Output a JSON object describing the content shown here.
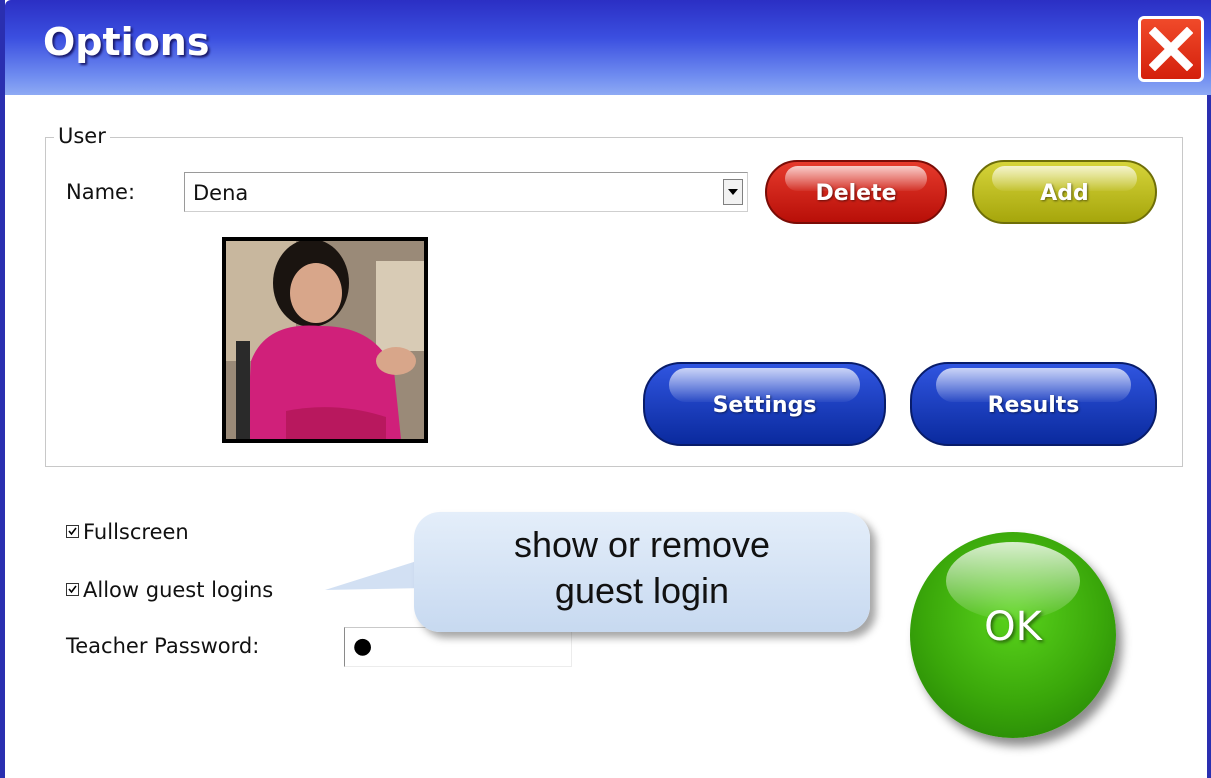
{
  "window": {
    "title": "Options",
    "close_icon": "close-x-icon"
  },
  "user_group": {
    "legend": "User",
    "name_label": "Name:",
    "name_value": "Dena",
    "delete_label": "Delete",
    "add_label": "Add",
    "settings_label": "Settings",
    "results_label": "Results",
    "photo": "user-photo"
  },
  "options": {
    "fullscreen_label": "Fullscreen",
    "fullscreen_checked": true,
    "guest_label": "Allow guest logins",
    "guest_checked": true,
    "password_label": "Teacher Password:",
    "password_value": "●"
  },
  "callout": {
    "line1": "show or remove",
    "line2": "guest login"
  },
  "ok_label": "OK",
  "colors": {
    "title_bar": "#3b4fe0",
    "close": "#e0301c",
    "delete": "#c81e12",
    "add": "#c2c020",
    "blue_buttons": "#1638b8",
    "ok": "#3aa70a",
    "callout": "#d4e2f4"
  }
}
